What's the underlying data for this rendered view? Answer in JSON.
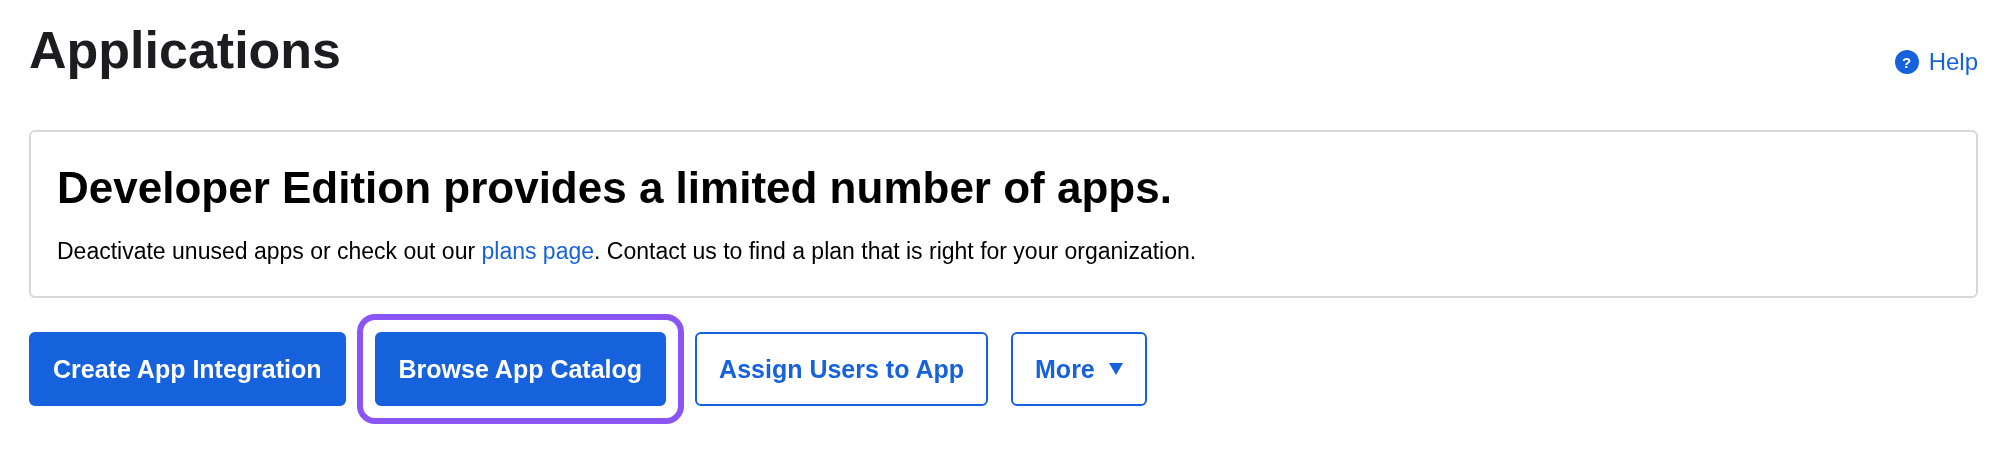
{
  "page": {
    "title": "Applications"
  },
  "help_link": {
    "label": "Help",
    "icon": "?"
  },
  "notice": {
    "heading": "Developer Edition provides a limited number of apps.",
    "text_before": "Deactivate unused apps or check out our ",
    "link": "plans page",
    "text_after": ". Contact us to find a plan that is right for your organization."
  },
  "actions": [
    {
      "label": "Create App Integration",
      "kind": "primary",
      "highlighted": false,
      "dropdown": false
    },
    {
      "label": "Browse App Catalog",
      "kind": "primary",
      "highlighted": true,
      "dropdown": false
    },
    {
      "label": "Assign Users to App",
      "kind": "secondary",
      "highlighted": false,
      "dropdown": false
    },
    {
      "label": "More",
      "kind": "secondary",
      "highlighted": false,
      "dropdown": true
    }
  ]
}
